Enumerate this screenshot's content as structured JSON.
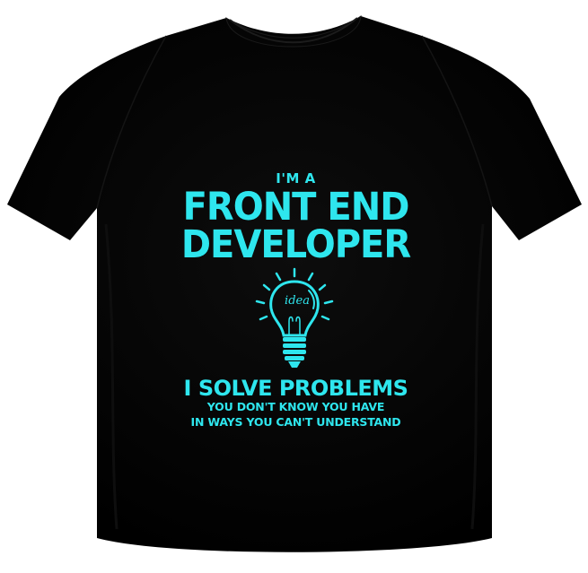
{
  "product": {
    "shirt_color": "#000000",
    "print_color": "#2ee6ee"
  },
  "print": {
    "line1": "I'M A",
    "line2": "FRONT END",
    "line3": "DEVELOPER",
    "bulb_word": "idea",
    "line4": "I SOLVE PROBLEMS",
    "line5": "YOU DON'T KNOW YOU HAVE",
    "line6": "IN WAYS YOU CAN'T UNDERSTAND"
  },
  "icons": {
    "bulb": "lightbulb-icon"
  }
}
